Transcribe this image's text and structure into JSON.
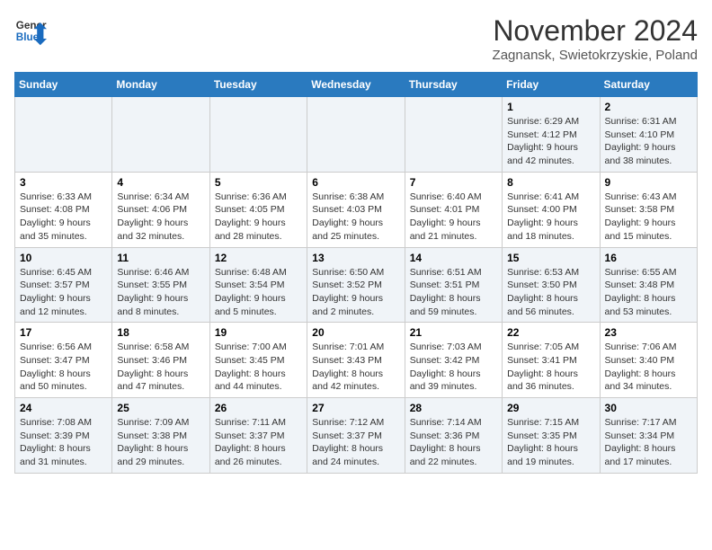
{
  "header": {
    "logo_line1": "General",
    "logo_line2": "Blue",
    "month": "November 2024",
    "location": "Zagnansk, Swietokrzyskie, Poland"
  },
  "weekdays": [
    "Sunday",
    "Monday",
    "Tuesday",
    "Wednesday",
    "Thursday",
    "Friday",
    "Saturday"
  ],
  "weeks": [
    [
      {
        "day": "",
        "info": ""
      },
      {
        "day": "",
        "info": ""
      },
      {
        "day": "",
        "info": ""
      },
      {
        "day": "",
        "info": ""
      },
      {
        "day": "",
        "info": ""
      },
      {
        "day": "1",
        "info": "Sunrise: 6:29 AM\nSunset: 4:12 PM\nDaylight: 9 hours and 42 minutes."
      },
      {
        "day": "2",
        "info": "Sunrise: 6:31 AM\nSunset: 4:10 PM\nDaylight: 9 hours and 38 minutes."
      }
    ],
    [
      {
        "day": "3",
        "info": "Sunrise: 6:33 AM\nSunset: 4:08 PM\nDaylight: 9 hours and 35 minutes."
      },
      {
        "day": "4",
        "info": "Sunrise: 6:34 AM\nSunset: 4:06 PM\nDaylight: 9 hours and 32 minutes."
      },
      {
        "day": "5",
        "info": "Sunrise: 6:36 AM\nSunset: 4:05 PM\nDaylight: 9 hours and 28 minutes."
      },
      {
        "day": "6",
        "info": "Sunrise: 6:38 AM\nSunset: 4:03 PM\nDaylight: 9 hours and 25 minutes."
      },
      {
        "day": "7",
        "info": "Sunrise: 6:40 AM\nSunset: 4:01 PM\nDaylight: 9 hours and 21 minutes."
      },
      {
        "day": "8",
        "info": "Sunrise: 6:41 AM\nSunset: 4:00 PM\nDaylight: 9 hours and 18 minutes."
      },
      {
        "day": "9",
        "info": "Sunrise: 6:43 AM\nSunset: 3:58 PM\nDaylight: 9 hours and 15 minutes."
      }
    ],
    [
      {
        "day": "10",
        "info": "Sunrise: 6:45 AM\nSunset: 3:57 PM\nDaylight: 9 hours and 12 minutes."
      },
      {
        "day": "11",
        "info": "Sunrise: 6:46 AM\nSunset: 3:55 PM\nDaylight: 9 hours and 8 minutes."
      },
      {
        "day": "12",
        "info": "Sunrise: 6:48 AM\nSunset: 3:54 PM\nDaylight: 9 hours and 5 minutes."
      },
      {
        "day": "13",
        "info": "Sunrise: 6:50 AM\nSunset: 3:52 PM\nDaylight: 9 hours and 2 minutes."
      },
      {
        "day": "14",
        "info": "Sunrise: 6:51 AM\nSunset: 3:51 PM\nDaylight: 8 hours and 59 minutes."
      },
      {
        "day": "15",
        "info": "Sunrise: 6:53 AM\nSunset: 3:50 PM\nDaylight: 8 hours and 56 minutes."
      },
      {
        "day": "16",
        "info": "Sunrise: 6:55 AM\nSunset: 3:48 PM\nDaylight: 8 hours and 53 minutes."
      }
    ],
    [
      {
        "day": "17",
        "info": "Sunrise: 6:56 AM\nSunset: 3:47 PM\nDaylight: 8 hours and 50 minutes."
      },
      {
        "day": "18",
        "info": "Sunrise: 6:58 AM\nSunset: 3:46 PM\nDaylight: 8 hours and 47 minutes."
      },
      {
        "day": "19",
        "info": "Sunrise: 7:00 AM\nSunset: 3:45 PM\nDaylight: 8 hours and 44 minutes."
      },
      {
        "day": "20",
        "info": "Sunrise: 7:01 AM\nSunset: 3:43 PM\nDaylight: 8 hours and 42 minutes."
      },
      {
        "day": "21",
        "info": "Sunrise: 7:03 AM\nSunset: 3:42 PM\nDaylight: 8 hours and 39 minutes."
      },
      {
        "day": "22",
        "info": "Sunrise: 7:05 AM\nSunset: 3:41 PM\nDaylight: 8 hours and 36 minutes."
      },
      {
        "day": "23",
        "info": "Sunrise: 7:06 AM\nSunset: 3:40 PM\nDaylight: 8 hours and 34 minutes."
      }
    ],
    [
      {
        "day": "24",
        "info": "Sunrise: 7:08 AM\nSunset: 3:39 PM\nDaylight: 8 hours and 31 minutes."
      },
      {
        "day": "25",
        "info": "Sunrise: 7:09 AM\nSunset: 3:38 PM\nDaylight: 8 hours and 29 minutes."
      },
      {
        "day": "26",
        "info": "Sunrise: 7:11 AM\nSunset: 3:37 PM\nDaylight: 8 hours and 26 minutes."
      },
      {
        "day": "27",
        "info": "Sunrise: 7:12 AM\nSunset: 3:37 PM\nDaylight: 8 hours and 24 minutes."
      },
      {
        "day": "28",
        "info": "Sunrise: 7:14 AM\nSunset: 3:36 PM\nDaylight: 8 hours and 22 minutes."
      },
      {
        "day": "29",
        "info": "Sunrise: 7:15 AM\nSunset: 3:35 PM\nDaylight: 8 hours and 19 minutes."
      },
      {
        "day": "30",
        "info": "Sunrise: 7:17 AM\nSunset: 3:34 PM\nDaylight: 8 hours and 17 minutes."
      }
    ]
  ]
}
